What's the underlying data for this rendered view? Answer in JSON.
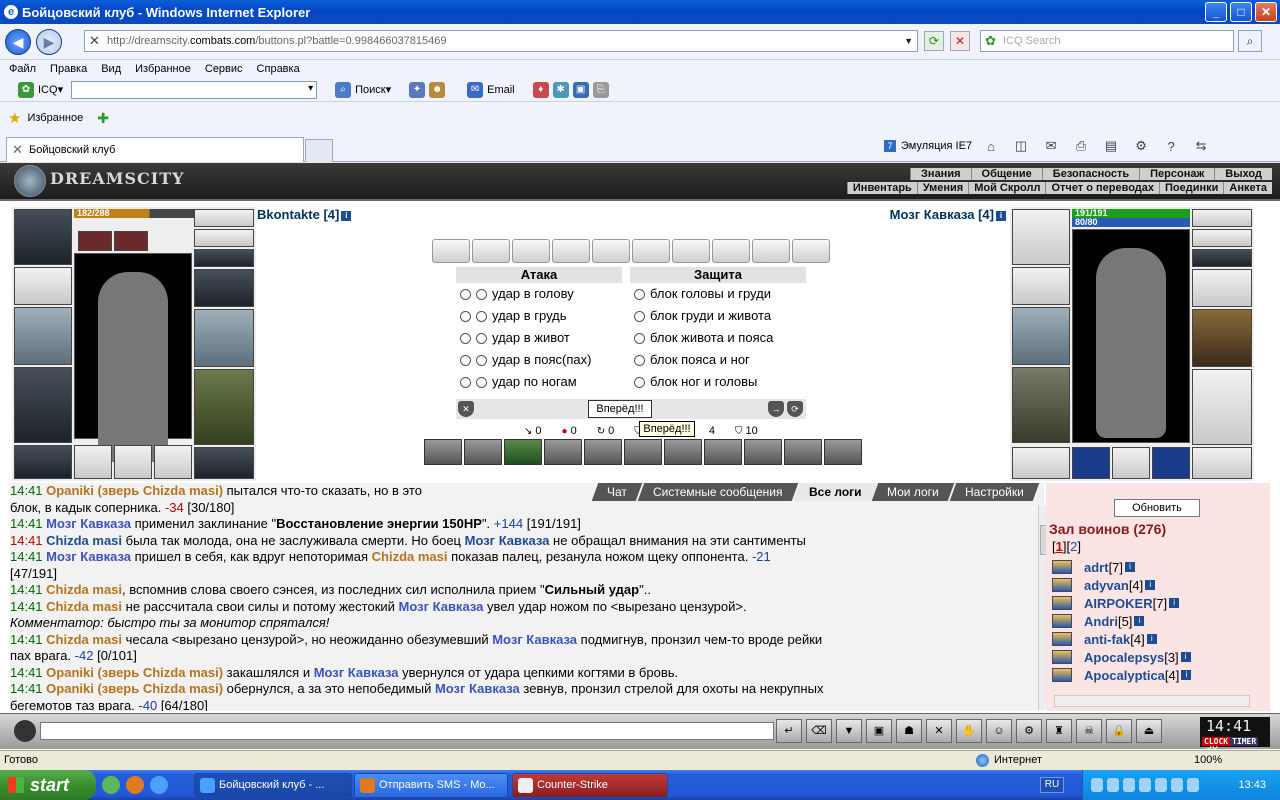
{
  "window": {
    "title": "Бойцовский клуб - Windows Internet Explorer"
  },
  "address": {
    "prefix": "http://dreamscity.",
    "domain": "combats.com",
    "suffix": "/buttons.pl?battle=0.998466037815469"
  },
  "search": {
    "placeholder": "ICQ Search"
  },
  "menu": [
    "Файл",
    "Правка",
    "Вид",
    "Избранное",
    "Сервис",
    "Справка"
  ],
  "toolbar": {
    "icq": "ICQ",
    "search": "Поиск",
    "email": "Email"
  },
  "favorites": {
    "label": "Избранное"
  },
  "tab": {
    "title": "Бойцовский клуб"
  },
  "right_tools": {
    "emulation": "Эмуляция IE7"
  },
  "game": {
    "logo": "DREAMSCITY",
    "menu_top": [
      "Знания",
      "Общение",
      "Безопасность",
      "Персонаж",
      "Выход"
    ],
    "menu_bottom": [
      "Инвентарь",
      "Умения",
      "Мой Скролл",
      "Отчет о переводах",
      "Поединки",
      "Анкета"
    ],
    "left": {
      "name": "Bkontakte [4]",
      "hp": "182/288",
      "hp_fraction": 0.63
    },
    "right": {
      "name": "Мозг Кавказа [4]",
      "hp": "191/191",
      "mana": "80/80",
      "hp_fraction": 1.0
    },
    "attack": {
      "title": "Атака",
      "options": [
        "удар в голову",
        "удар в грудь",
        "удар в живот",
        "удар в пояс(пах)",
        "удар по ногам"
      ]
    },
    "defense": {
      "title": "Защита",
      "options": [
        "блок головы и груди",
        "блок груди и живота",
        "блок живота и пояса",
        "блок пояса и ног",
        "блок ног и головы"
      ]
    },
    "forward_button": "Вперёд!!!",
    "tooltip": "Вперёд!!!",
    "stats": [
      "0",
      "0",
      "0",
      "3",
      "4",
      "10"
    ],
    "chat_tabs": [
      "Чат",
      "Системные сообщения",
      "Все логи",
      "Мои логи",
      "Настройки"
    ],
    "log": [
      {
        "time": "14:41",
        "parts": [
          {
            "t": "Opaniki (зверь Chizda masi)",
            "c": "orange"
          },
          {
            "t": " пытался что-то сказать, но в это"
          }
        ]
      },
      {
        "time": "",
        "parts": [
          {
            "t": "блок, в кадык соперника. "
          },
          {
            "t": "-34",
            "c": "red"
          },
          {
            "t": " [30/180]"
          }
        ]
      },
      {
        "time": "14:41",
        "parts": [
          {
            "t": "Мозг Кавказа",
            "c": "blue"
          },
          {
            "t": " применил заклинание \""
          },
          {
            "t": "Восстановление энергии 150HP",
            "c": "b"
          },
          {
            "t": "\". "
          },
          {
            "t": "+144",
            "c": "dmg"
          },
          {
            "t": " [191/191]"
          }
        ]
      },
      {
        "time": "14:41",
        "red": true,
        "parts": [
          {
            "t": "Chizda masi",
            "c": "nick"
          },
          {
            "t": " была так молода, она не заслуживала смерти. Но боец "
          },
          {
            "t": "Мозг Кавказа",
            "c": "nick"
          },
          {
            "t": " не обращал внимания на эти сантименты"
          }
        ]
      },
      {
        "time": "14:41",
        "parts": [
          {
            "t": "Мозг Кавказа",
            "c": "blue"
          },
          {
            "t": " пришел в себя, как вдруг непоторимая "
          },
          {
            "t": "Chizda masi",
            "c": "orange"
          },
          {
            "t": " показав палец, резанула ножом щеку оппонента. "
          },
          {
            "t": "-21",
            "c": "dmg"
          }
        ]
      },
      {
        "time": "",
        "parts": [
          {
            "t": "[47/191]"
          }
        ]
      },
      {
        "time": "14:41",
        "parts": [
          {
            "t": "Chizda masi",
            "c": "orange"
          },
          {
            "t": ", вспомнив слова своего сэнсея, из последних сил исполнила прием \""
          },
          {
            "t": "Сильный удар",
            "c": "b"
          },
          {
            "t": "\".."
          }
        ]
      },
      {
        "time": "14:41",
        "parts": [
          {
            "t": "Chizda masi",
            "c": "orange"
          },
          {
            "t": " не рассчитала свои силы и потому жестокий "
          },
          {
            "t": "Мозг Кавказа",
            "c": "blue"
          },
          {
            "t": " увел удар ножом по <вырезано цензурой>."
          }
        ]
      },
      {
        "time": "",
        "parts": [
          {
            "t": "Комментатор: быстро ты за монитор спрятался!",
            "c": "cmt"
          }
        ]
      },
      {
        "time": "14:41",
        "parts": [
          {
            "t": "Chizda masi",
            "c": "orange"
          },
          {
            "t": " чесала <вырезано цензурой>, но неожиданно обезумевший "
          },
          {
            "t": "Мозг Кавказа",
            "c": "blue"
          },
          {
            "t": " подмигнув, пронзил чем-то вроде рейки"
          }
        ]
      },
      {
        "time": "",
        "parts": [
          {
            "t": "пах врага. "
          },
          {
            "t": "-42",
            "c": "dmg"
          },
          {
            "t": " [0/101]"
          }
        ]
      },
      {
        "time": "14:41",
        "parts": [
          {
            "t": "Opaniki (зверь Chizda masi)",
            "c": "orange"
          },
          {
            "t": " закашлялся и "
          },
          {
            "t": "Мозг Кавказа",
            "c": "blue"
          },
          {
            "t": " увернулся от удара цепкими когтями в бровь."
          }
        ]
      },
      {
        "time": "14:41",
        "parts": [
          {
            "t": "Opaniki (зверь Chizda masi)",
            "c": "orange"
          },
          {
            "t": " обернулся, а за это непобедимый "
          },
          {
            "t": "Мозг Кавказа",
            "c": "blue"
          },
          {
            "t": " зевнув, пронзил стрелой для охоты на некрупных"
          }
        ]
      },
      {
        "time": "",
        "parts": [
          {
            "t": "бегемотов таз врага. "
          },
          {
            "t": "-40",
            "c": "dmg"
          },
          {
            "t": " [64/180]"
          }
        ]
      }
    ],
    "refresh_button": "Обновить",
    "hall_title": "Зал воинов (276)",
    "pages": {
      "current": "1",
      "next": "2"
    },
    "players": [
      {
        "name": "adrt",
        "level": "[7]"
      },
      {
        "name": "adyvan",
        "level": "[4]"
      },
      {
        "name": "AIRPOKER",
        "level": "[7]"
      },
      {
        "name": "Andri",
        "level": "[5]"
      },
      {
        "name": "anti-fak",
        "level": "[4]"
      },
      {
        "name": "Apocalepsys",
        "level": "[3]"
      },
      {
        "name": "Apocalyptica",
        "level": "[4]"
      }
    ],
    "clock": {
      "time": "14:41",
      "seconds": "58",
      "label_clock": "CLOCK",
      "label_timer": "TIMER"
    }
  },
  "status": {
    "ready": "Готово",
    "zone": "Интернет",
    "zoom": "100%"
  },
  "taskbar": {
    "start": "start",
    "tasks": [
      "Бойцовский клуб - ...",
      "Отправить SMS - Mo...",
      "Counter-Strike"
    ],
    "lang": "RU",
    "time": "13:43"
  }
}
